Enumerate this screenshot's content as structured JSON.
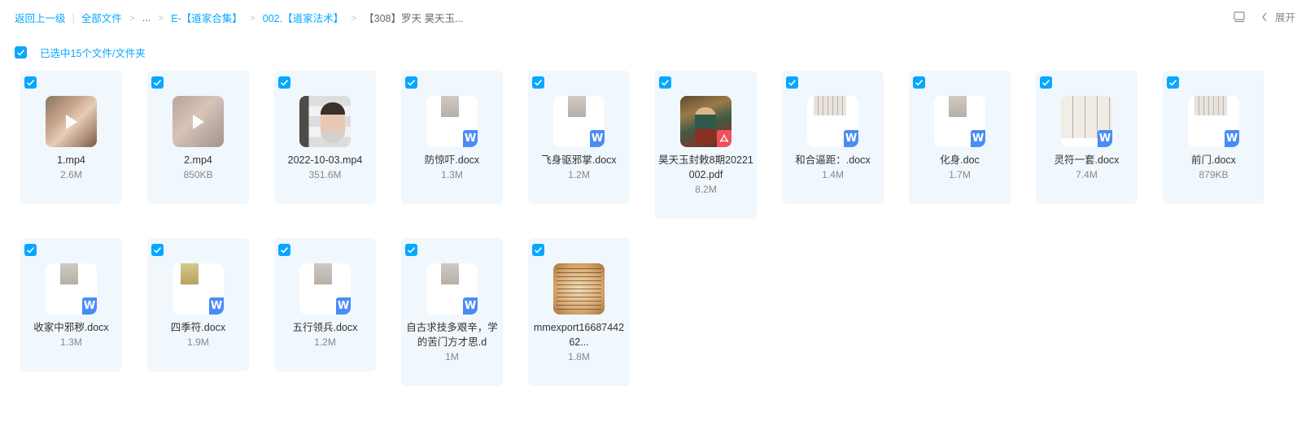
{
  "breadcrumb": {
    "back": "返回上一级",
    "all_files": "全部文件",
    "ellipsis": "...",
    "crumb1": "E-【道家合集】",
    "crumb2": "002.【道家法术】",
    "current": "【308】罗天 昊天玉..."
  },
  "toolbar": {
    "expand_label": "展开"
  },
  "selection": {
    "text": "已选中15个文件/文件夹"
  },
  "colors": {
    "accent": "#06a7ff",
    "card_bg": "#f0f7fd",
    "word_badge": "#4a8cf6",
    "pdf_badge": "#f0505a"
  },
  "files": [
    {
      "name": "1.mp4",
      "size": "2.6M",
      "kind": "video",
      "icon": "video-thumbnail"
    },
    {
      "name": "2.mp4",
      "size": "850KB",
      "kind": "video",
      "icon": "video-thumbnail"
    },
    {
      "name": "2022-10-03.mp4",
      "size": "351.6M",
      "kind": "video",
      "icon": "video-thumbnail"
    },
    {
      "name": "防惊吓.docx",
      "size": "1.3M",
      "kind": "word",
      "icon": "word-icon"
    },
    {
      "name": "飞身驱邪掌.docx",
      "size": "1.2M",
      "kind": "word",
      "icon": "word-icon"
    },
    {
      "name": "昊天玉封敕8期20221002.pdf",
      "size": "8.2M",
      "kind": "pdf",
      "icon": "pdf-icon"
    },
    {
      "name": "和合逼距：.docx",
      "size": "1.4M",
      "kind": "word",
      "icon": "word-icon"
    },
    {
      "name": "化身.doc",
      "size": "1.7M",
      "kind": "word",
      "icon": "word-icon"
    },
    {
      "name": "灵符一套.docx",
      "size": "7.4M",
      "kind": "word",
      "icon": "word-icon"
    },
    {
      "name": "前门.docx",
      "size": "879KB",
      "kind": "word",
      "icon": "word-icon"
    },
    {
      "name": "收家中邪秽.docx",
      "size": "1.3M",
      "kind": "word",
      "icon": "word-icon"
    },
    {
      "name": "四季符.docx",
      "size": "1.9M",
      "kind": "word",
      "icon": "word-icon"
    },
    {
      "name": "五行领兵.docx",
      "size": "1.2M",
      "kind": "word",
      "icon": "word-icon"
    },
    {
      "name": "自古求技多艰辛，学的苦门方才思.d",
      "size": "1M",
      "kind": "word",
      "icon": "word-icon"
    },
    {
      "name": "mmexport1668744262...",
      "size": "1.8M",
      "kind": "image",
      "icon": "image-thumbnail"
    }
  ]
}
